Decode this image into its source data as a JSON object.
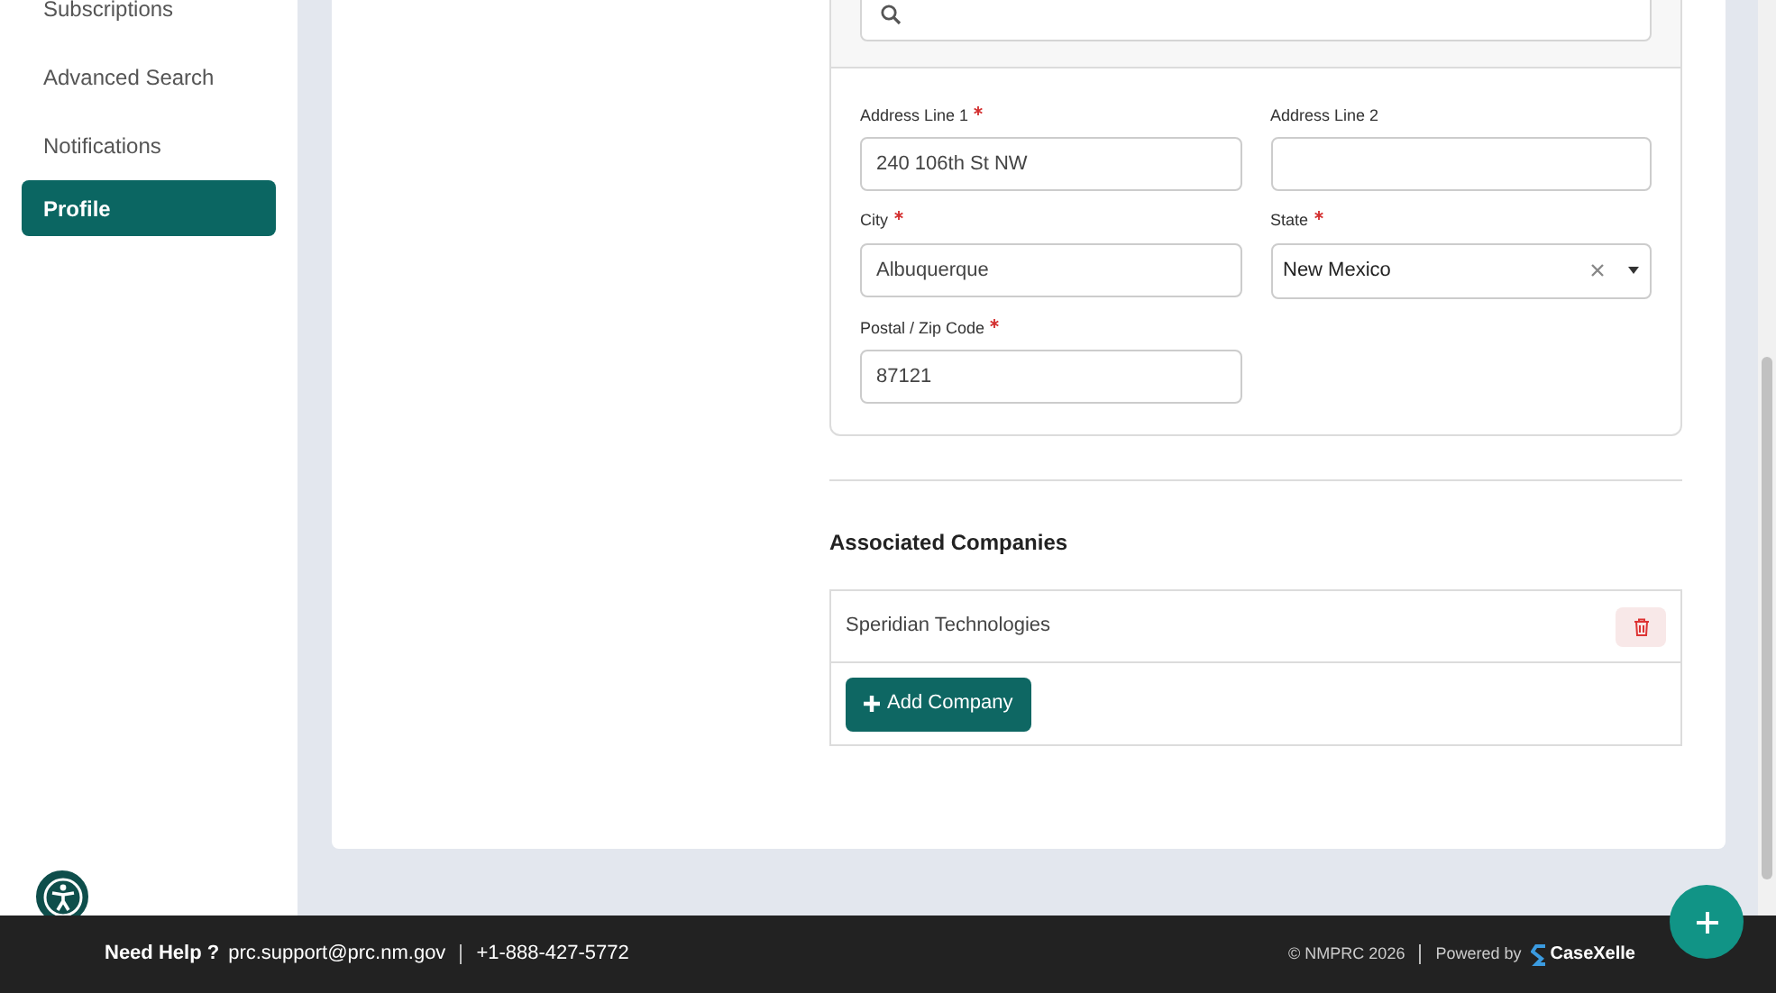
{
  "sidebar": {
    "items": [
      {
        "label": "Subscriptions",
        "selected": false
      },
      {
        "label": "Advanced Search",
        "selected": false
      },
      {
        "label": "Notifications",
        "selected": false
      },
      {
        "label": "Profile",
        "selected": true
      }
    ]
  },
  "address_form": {
    "fields": [
      {
        "kind": "text",
        "label": "Address Line 1",
        "required": true,
        "value": "240 106th St NW"
      },
      {
        "kind": "text",
        "label": "Address Line 2",
        "required": false
      },
      {
        "kind": "text",
        "label": "City",
        "required": true,
        "value": "Albuquerque"
      },
      {
        "kind": "select",
        "label": "State",
        "required": true,
        "value": "New Mexico"
      },
      {
        "kind": "text",
        "label": "Postal / Zip Code",
        "required": true,
        "value": "87121"
      }
    ]
  },
  "associated_companies": {
    "title": "Associated Companies",
    "rows": [
      {
        "name": "Speridian Technologies"
      }
    ],
    "add_button": {
      "label": "Add Company"
    }
  },
  "footer": {
    "help_label": "Need Help ?",
    "email": "prc.support@prc.nm.gov",
    "phone": "+1-888-427-5772",
    "copyright": "© NMPRC 2026",
    "powered_by": "Powered by",
    "brand": "CaseXelle"
  }
}
